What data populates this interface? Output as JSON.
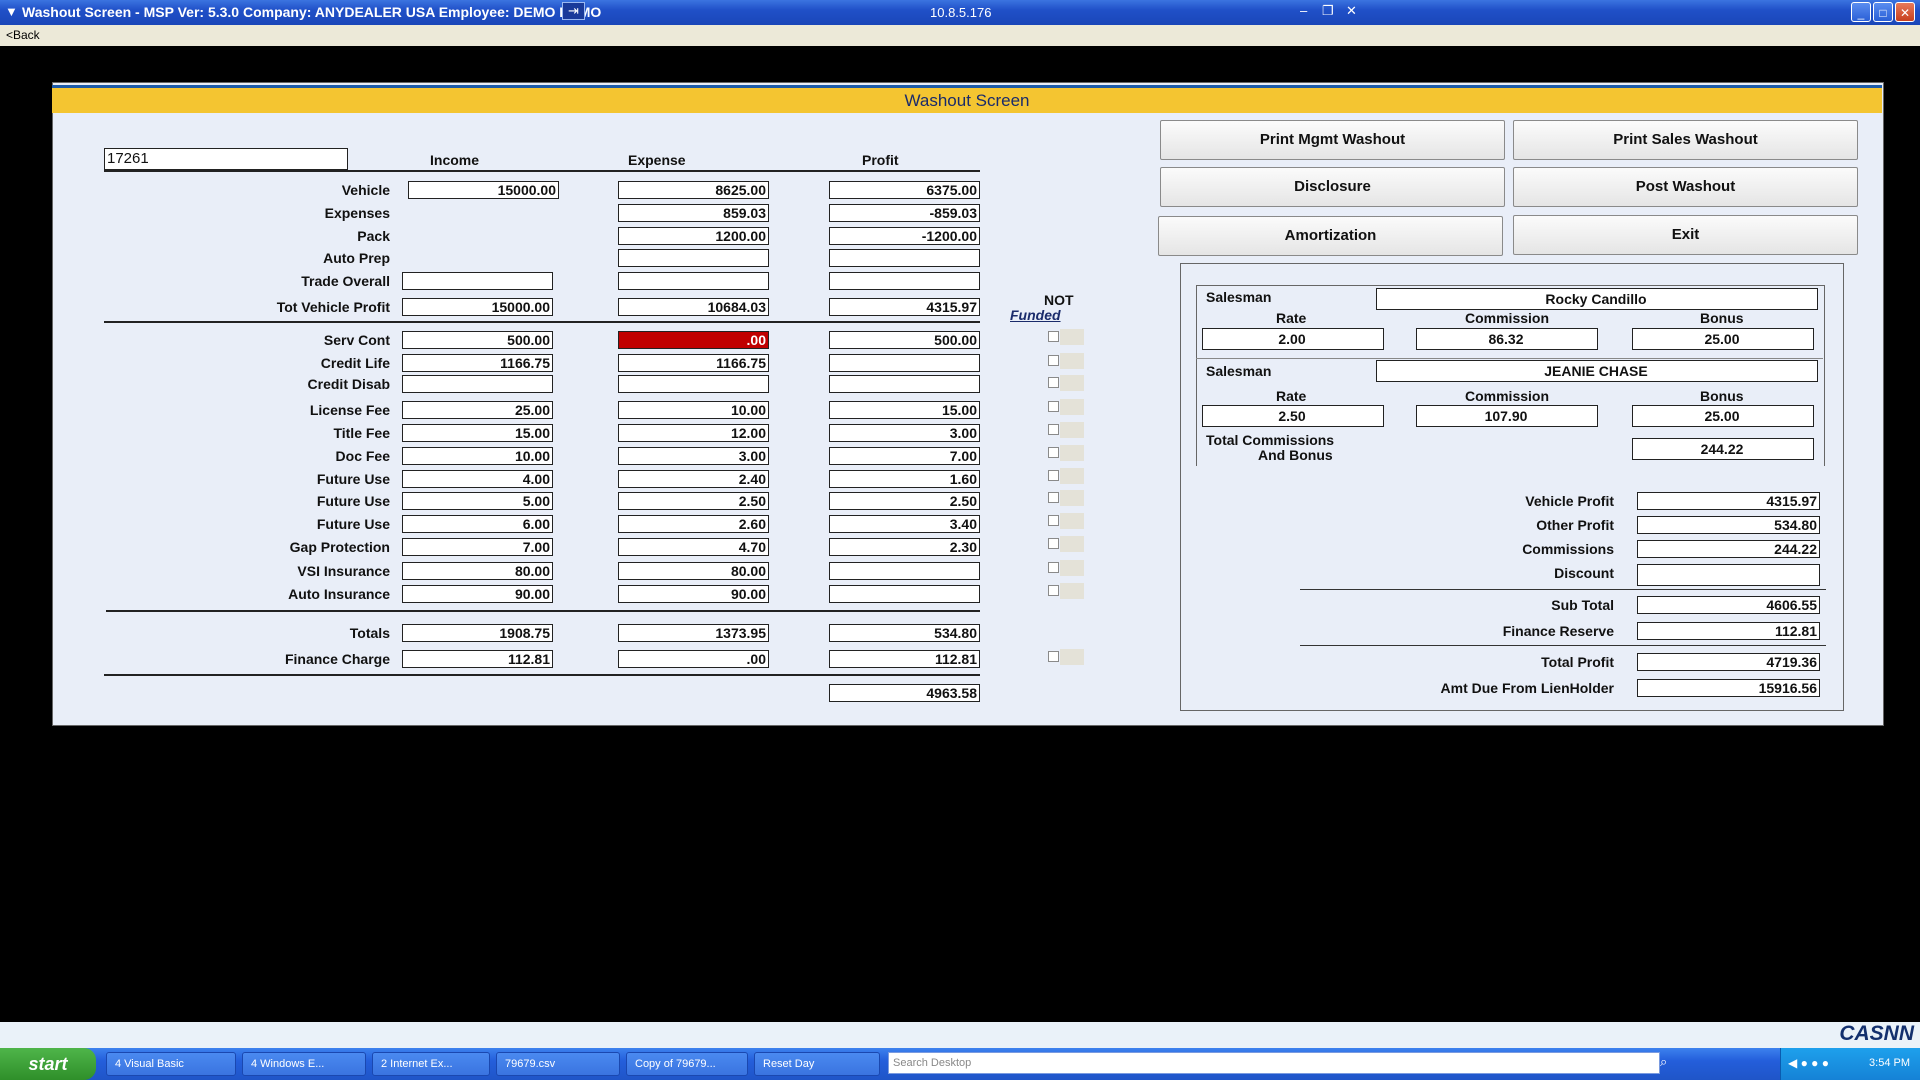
{
  "titlebar": {
    "title": "Washout Screen - MSP Ver: 5.3.0 Company: ANYDEALER USA Employee: DEMO DEMO",
    "ip": "10.8.5.176"
  },
  "back_label": "<Back",
  "header": "Washout Screen",
  "deal_number": "17261",
  "columns": {
    "income": "Income",
    "expense": "Expense",
    "profit": "Profit"
  },
  "not_funded": {
    "not": "NOT",
    "funded": "Funded"
  },
  "rows": [
    {
      "label": "Vehicle",
      "income": "15000.00",
      "expense": "8625.00",
      "profit": "6375.00"
    },
    {
      "label": "Expenses",
      "income": "",
      "expense": "859.03",
      "profit": "-859.03"
    },
    {
      "label": "Pack",
      "income": "",
      "expense": "1200.00",
      "profit": "-1200.00"
    },
    {
      "label": "Auto Prep",
      "income": "",
      "expense": "",
      "profit": ""
    },
    {
      "label": "Trade Overall",
      "income": "",
      "expense": "",
      "profit": ""
    },
    {
      "label": "Tot Vehicle Profit",
      "income": "15000.00",
      "expense": "10684.03",
      "profit": "4315.97"
    },
    {
      "label": "Serv Cont",
      "income": "500.00",
      "expense": ".00",
      "profit": "500.00"
    },
    {
      "label": "Credit Life",
      "income": "1166.75",
      "expense": "1166.75",
      "profit": ""
    },
    {
      "label": "Credit Disab",
      "income": "",
      "expense": "",
      "profit": ""
    },
    {
      "label": "License Fee",
      "income": "25.00",
      "expense": "10.00",
      "profit": "15.00"
    },
    {
      "label": "Title Fee",
      "income": "15.00",
      "expense": "12.00",
      "profit": "3.00"
    },
    {
      "label": "Doc Fee",
      "income": "10.00",
      "expense": "3.00",
      "profit": "7.00"
    },
    {
      "label": "Future Use",
      "income": "4.00",
      "expense": "2.40",
      "profit": "1.60"
    },
    {
      "label": "Future Use",
      "income": "5.00",
      "expense": "2.50",
      "profit": "2.50"
    },
    {
      "label": "Future Use",
      "income": "6.00",
      "expense": "2.60",
      "profit": "3.40"
    },
    {
      "label": "Gap Protection",
      "income": "7.00",
      "expense": "4.70",
      "profit": "2.30"
    },
    {
      "label": "VSI Insurance",
      "income": "80.00",
      "expense": "80.00",
      "profit": ""
    },
    {
      "label": "Auto Insurance",
      "income": "90.00",
      "expense": "90.00",
      "profit": ""
    },
    {
      "label": "Totals",
      "income": "1908.75",
      "expense": "1373.95",
      "profit": "534.80"
    },
    {
      "label": "Finance Charge",
      "income": "112.81",
      "expense": ".00",
      "profit": "112.81"
    }
  ],
  "grand_total": "4963.58",
  "buttons": {
    "print_mgmt": "Print Mgmt Washout",
    "print_sales": "Print Sales Washout",
    "disclosure": "Disclosure",
    "post_washout": "Post Washout",
    "amortization": "Amortization",
    "exit": "Exit"
  },
  "salesmen": [
    {
      "label": "Salesman",
      "name": "Rocky Candillo",
      "rate_label": "Rate",
      "commission_label": "Commission",
      "bonus_label": "Bonus",
      "rate": "2.00",
      "commission": "86.32",
      "bonus": "25.00"
    },
    {
      "label": "Salesman",
      "name": "JEANIE CHASE",
      "rate_label": "Rate",
      "commission_label": "Commission",
      "bonus_label": "Bonus",
      "rate": "2.50",
      "commission": "107.90",
      "bonus": "25.00"
    }
  ],
  "total_commissions": {
    "label_line1": "Total Commissions",
    "label_line2": "And Bonus",
    "value": "244.22"
  },
  "summary": [
    {
      "label": "Vehicle Profit",
      "value": "4315.97"
    },
    {
      "label": "Other Profit",
      "value": "534.80"
    },
    {
      "label": "Commissions",
      "value": "244.22"
    },
    {
      "label": "Discount",
      "value": ""
    },
    {
      "label": "Sub Total",
      "value": "4606.55"
    },
    {
      "label": "Finance Reserve",
      "value": "112.81"
    },
    {
      "label": "Total Profit",
      "value": "4719.36"
    },
    {
      "label": "Amt Due From LienHolder",
      "value": "15916.56"
    }
  ],
  "brand": "CASNN",
  "taskbar": {
    "start": "start",
    "tasks": [
      "4 Visual Basic",
      "4 Windows E...",
      "2 Internet Ex...",
      "79679.csv",
      "Copy of 79679...",
      "Reset Day"
    ],
    "search_placeholder": "Search Desktop",
    "clock": "3:54 PM"
  },
  "colors": {
    "header": "#f4c531",
    "highlight_cell": "#c00000",
    "panel": "#e9eef8"
  }
}
